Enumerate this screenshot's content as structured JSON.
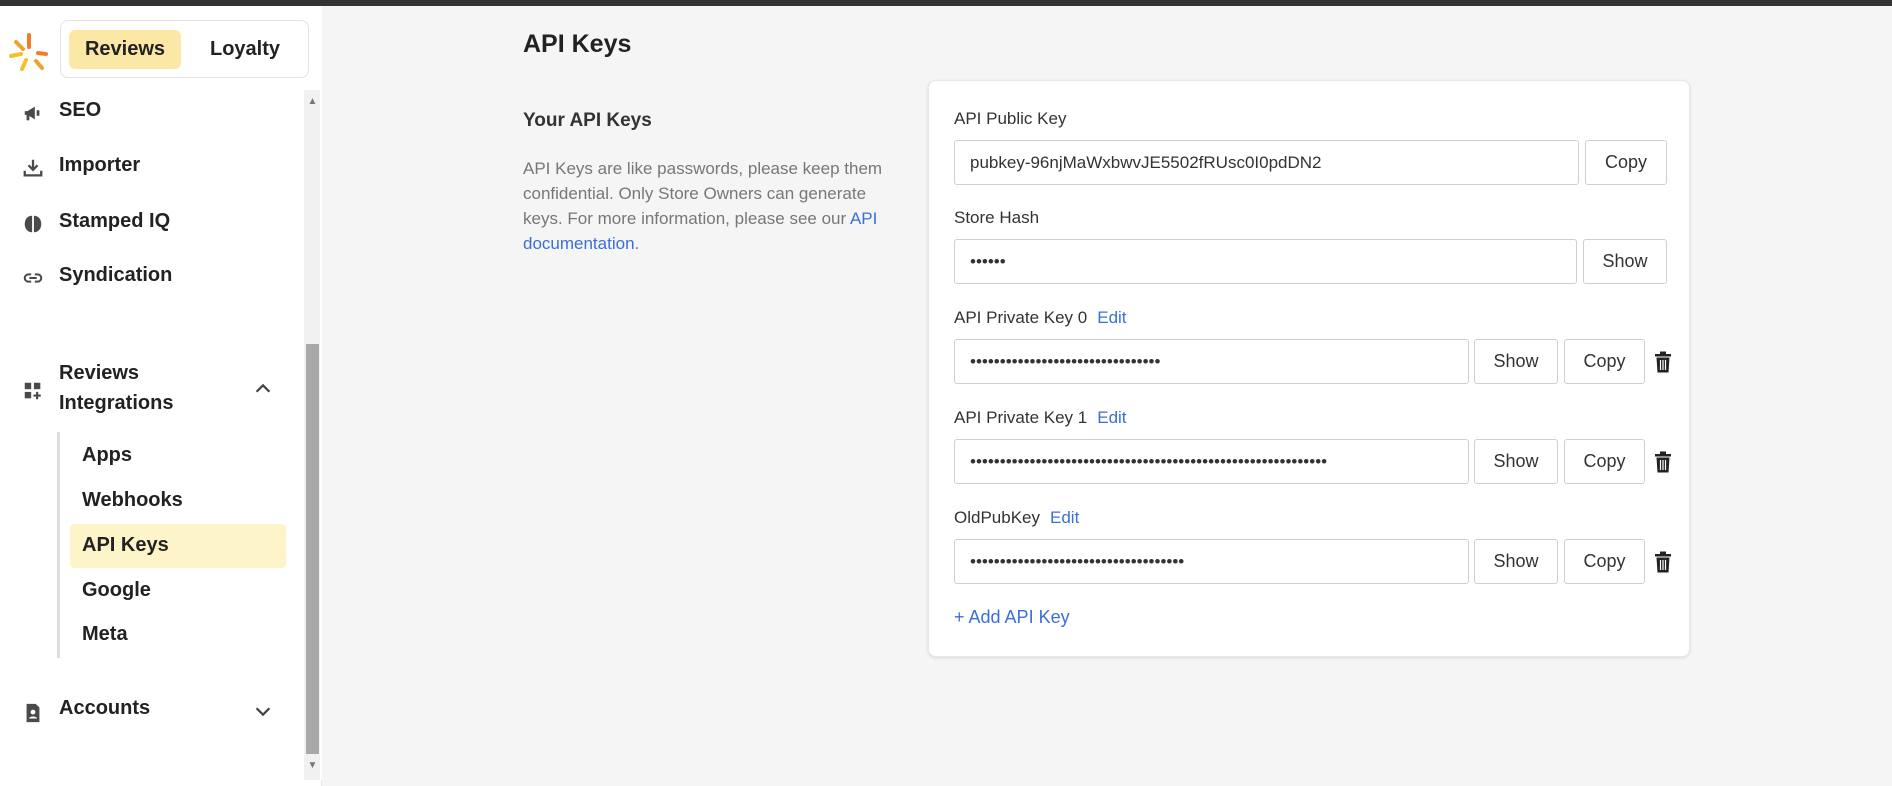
{
  "app": {
    "switcher": {
      "active": "Reviews",
      "inactive": "Loyalty"
    }
  },
  "sidebar": {
    "items": [
      {
        "label": "SEO",
        "icon": "megaphone-icon"
      },
      {
        "label": "Importer",
        "icon": "download-icon"
      },
      {
        "label": "Stamped IQ",
        "icon": "brain-icon"
      },
      {
        "label": "Syndication",
        "icon": "link-icon"
      }
    ],
    "group": {
      "label": "Reviews Integrations",
      "icon": "apps-plus-icon",
      "expanded": true,
      "children": [
        {
          "label": "Apps"
        },
        {
          "label": "Webhooks"
        },
        {
          "label": "API Keys",
          "active": true
        },
        {
          "label": "Google"
        },
        {
          "label": "Meta"
        }
      ]
    },
    "accounts": {
      "label": "Accounts",
      "icon": "account-file-icon",
      "expanded": false
    }
  },
  "main": {
    "title": "API Keys",
    "section": {
      "title": "Your API Keys",
      "description": "API Keys are like passwords, please keep them confidential. Only Store Owners can generate keys. For more information, please see our ",
      "link": "API documentation",
      "suffix": "."
    },
    "fields": {
      "public_key": {
        "label": "API Public Key",
        "value": "pubkey-96njMaWxbwvJE5502fRUsc0I0pdDN2",
        "copy": "Copy"
      },
      "store_hash": {
        "label": "Store Hash",
        "value": "••••••",
        "show": "Show"
      },
      "private_keys": [
        {
          "label": "API Private Key 0",
          "edit": "Edit",
          "value": "••••••••••••••••••••••••••••••••",
          "show": "Show",
          "copy": "Copy"
        },
        {
          "label": "API Private Key 1",
          "edit": "Edit",
          "value": "••••••••••••••••••••••••••••••••••••••••••••••••••••••••••••",
          "show": "Show",
          "copy": "Copy"
        },
        {
          "label": "OldPubKey",
          "edit": "Edit",
          "value": "••••••••••••••••••••••••••••••••••••",
          "show": "Show",
          "copy": "Copy"
        }
      ]
    },
    "add_key": "+ Add API Key"
  },
  "colors": {
    "accent_yellow": "#fbe8a6",
    "active_sub_bg": "#fdf5c9",
    "link_blue": "#3a6fd8"
  }
}
